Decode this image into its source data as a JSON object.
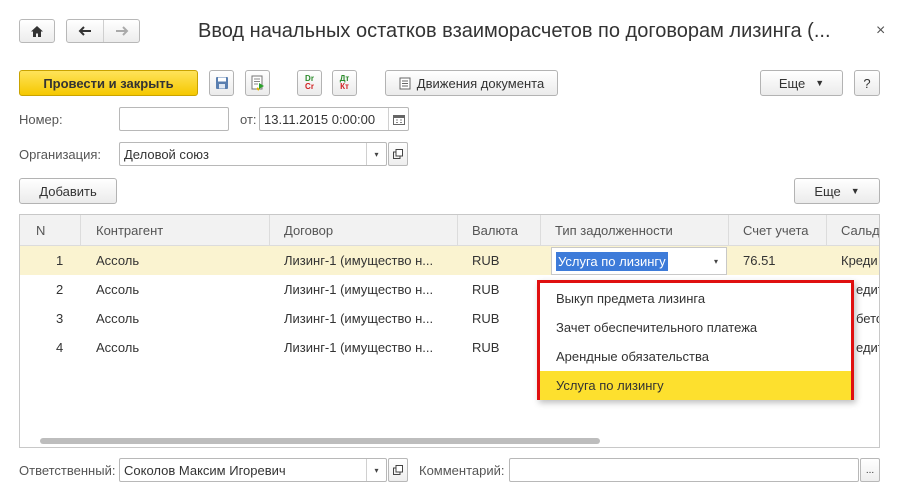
{
  "window": {
    "title": "Ввод начальных остатков взаиморасчетов по договорам лизинга (...",
    "close_glyph": "×"
  },
  "toolbar": {
    "post_close_label": "Провести и закрыть",
    "dt_icon_top": "Dr",
    "dt_icon_bottom": "Cr",
    "dt2_icon_top": "Дт",
    "dt2_icon_bottom": "Кт",
    "movements_label": "Движения документа",
    "more_label": "Еще",
    "help_label": "?"
  },
  "form": {
    "number_label": "Номер:",
    "number_value": "",
    "from_label": "от:",
    "date_value": "13.11.2015  0:00:00",
    "org_label": "Организация:",
    "org_value": "Деловой союз",
    "responsible_label": "Ответственный:",
    "responsible_value": "Соколов Максим Игоревич",
    "comment_label": "Комментарий:",
    "comment_value": "",
    "comment_btn": "..."
  },
  "table_toolbar": {
    "add_label": "Добавить",
    "more_label": "Еще"
  },
  "table": {
    "columns": [
      "N",
      "Контрагент",
      "Договор",
      "Валюта",
      "Тип задолженности",
      "Счет учета",
      "Сальд"
    ],
    "rows": [
      {
        "n": "1",
        "counterparty": "Ассоль",
        "contract": "Лизинг-1 (имущество н...",
        "currency": "RUB",
        "debt_type": "Услуга по лизингу",
        "account": "76.51",
        "balance": "Креди"
      },
      {
        "n": "2",
        "counterparty": "Ассоль",
        "contract": "Лизинг-1 (имущество н...",
        "currency": "RUB",
        "debt_type": "",
        "account": "",
        "balance": "едит"
      },
      {
        "n": "3",
        "counterparty": "Ассоль",
        "contract": "Лизинг-1 (имущество н...",
        "currency": "RUB",
        "debt_type": "",
        "account": "",
        "balance": "бето"
      },
      {
        "n": "4",
        "counterparty": "Ассоль",
        "contract": "Лизинг-1 (имущество н...",
        "currency": "RUB",
        "debt_type": "",
        "account": "",
        "balance": "едит"
      }
    ]
  },
  "dropdown": {
    "items": [
      "Выкуп предмета лизинга",
      "Зачет обеспечительного платежа",
      "Арендные обязательства",
      "Услуга по лизингу"
    ],
    "selected_index": 3
  },
  "icons": {
    "home": "home-icon",
    "back": "arrow-left-icon",
    "forward": "arrow-right-icon",
    "save": "floppy-disk-icon",
    "post": "post-document-icon",
    "dt_kt": "debit-credit-icon",
    "movements": "document-movements-icon",
    "calendar": "calendar-icon",
    "open": "open-object-icon"
  },
  "colors": {
    "primary_button": "#f5c800",
    "selected_row": "#faf3d0",
    "popup_border": "#e01010",
    "popup_selected": "#fde02e",
    "edit_highlight": "#3d7bd9"
  }
}
